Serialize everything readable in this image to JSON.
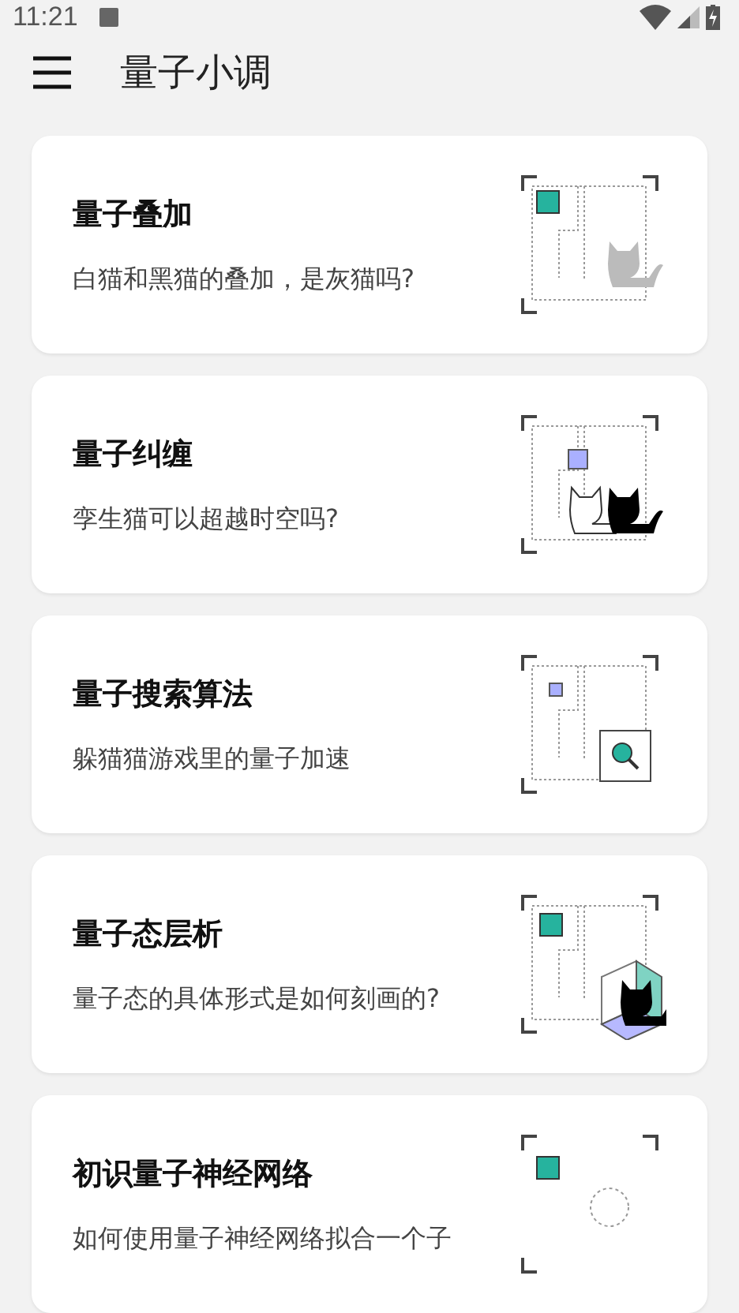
{
  "status_bar": {
    "time": "11:21"
  },
  "app_bar": {
    "title": "量子小调"
  },
  "cards": [
    {
      "kind": "superposition",
      "title": "量子叠加",
      "subtitle": "白猫和黑猫的叠加，是灰猫吗?"
    },
    {
      "kind": "entanglement",
      "title": "量子纠缠",
      "subtitle": "孪生猫可以超越时空吗?"
    },
    {
      "kind": "search",
      "title": "量子搜索算法",
      "subtitle": "躲猫猫游戏里的量子加速"
    },
    {
      "kind": "tomography",
      "title": "量子态层析",
      "subtitle": "量子态的具体形式是如何刻画的?"
    },
    {
      "kind": "network",
      "title": "初识量子神经网络",
      "subtitle": "如何使用量子神经网络拟合一个子"
    }
  ]
}
